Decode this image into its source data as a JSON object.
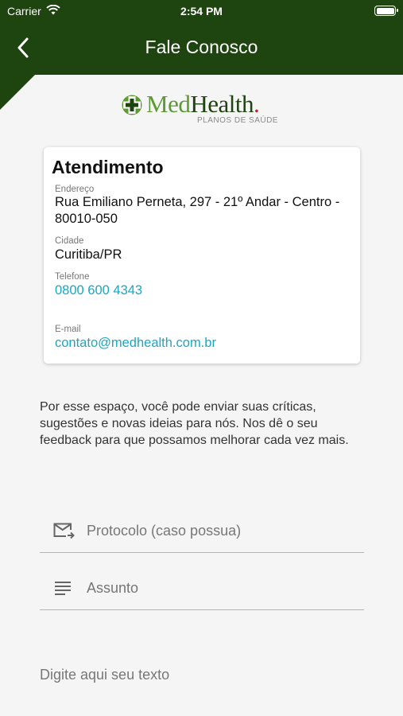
{
  "status": {
    "carrier": "Carrier",
    "time": "2:54 PM"
  },
  "header": {
    "title": "Fale Conosco"
  },
  "logo": {
    "brand_med": "Med",
    "brand_health": "Health",
    "tagline": "PLANOS DE SAÚDE"
  },
  "card": {
    "title": "Atendimento",
    "address_label": "Endereço",
    "address_value": "Rua Emiliano Perneta, 297 - 21º Andar - Centro - 80010-050",
    "city_label": "Cidade",
    "city_value": "Curitiba/PR",
    "phone_label": "Telefone",
    "phone_value": "0800 600 4343",
    "email_label": "E-mail",
    "email_value": "contato@medhealth.com.br"
  },
  "description": "Por esse espaço, você pode enviar suas críticas, sugestões e novas ideias para nós. Nos dê o seu feedback para que possamos melhorar cada vez mais.",
  "form": {
    "protocol_placeholder": "Protocolo (caso possua)",
    "subject_placeholder": "Assunto",
    "message_placeholder": "Digite aqui seu texto"
  },
  "colors": {
    "primary": "#1e4410",
    "accent": "#5e9a32",
    "link": "#17a8c4",
    "brand_dot": "#c0262c"
  },
  "icons": [
    "wifi-icon",
    "battery-icon",
    "back-arrow-icon",
    "logo-cross-icon",
    "mail-forward-icon",
    "subject-lines-icon"
  ]
}
